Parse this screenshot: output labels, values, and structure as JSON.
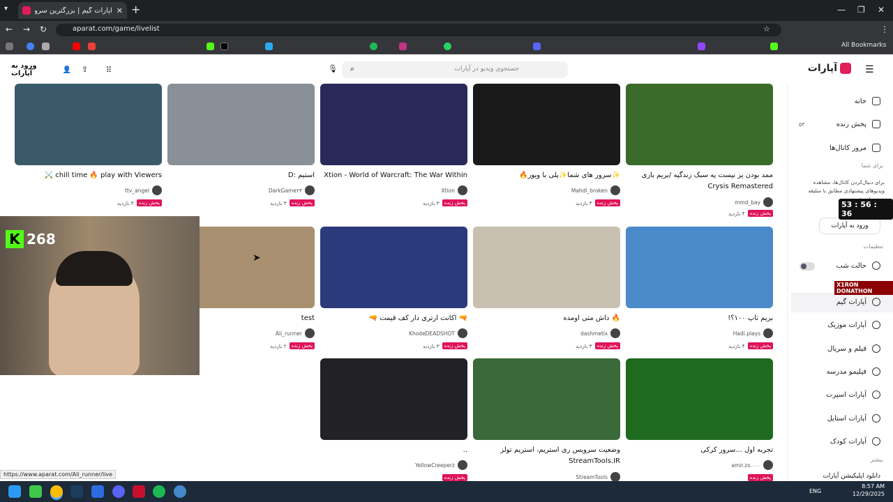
{
  "browser": {
    "tab_title": "آپارات گیم | بزرگترین سرویس استر",
    "url": "aparat.com/game/livelist",
    "all_bookmarks": "All Bookmarks",
    "status_url": "https://www.aparat.com/Ali_runner/live"
  },
  "header": {
    "logo": "آپارات",
    "search_placeholder": "جستجوی ویدیو در آپارات",
    "login": "ورود به آپارات"
  },
  "sidebar": {
    "items": [
      {
        "label": "خانه",
        "icon": "home-icon"
      },
      {
        "label": "پخش زنده",
        "icon": "live-icon",
        "count": "۵۳"
      },
      {
        "label": "مرور کانال‌ها",
        "icon": "channels-icon"
      },
      {
        "label": "حالت شب",
        "icon": "moon-icon"
      },
      {
        "label": "آپارات گیم",
        "icon": "game-icon"
      },
      {
        "label": "آپارات موزیک",
        "icon": "music-icon"
      },
      {
        "label": "فیلم و سریال",
        "icon": "film-icon"
      },
      {
        "label": "فیلیمو مدرسه",
        "icon": "school-icon"
      },
      {
        "label": "آپارات اسپرت",
        "icon": "sport-icon"
      },
      {
        "label": "آپارات استایل",
        "icon": "style-icon"
      },
      {
        "label": "آپارات کودک",
        "icon": "kids-icon"
      }
    ],
    "for_you": "برای شما",
    "for_you_text": "برای دنبال‌کردن کانال‌ها، مشاهده ویدیوهای پیشنهادی مطابق با سلیقه خود، وارد شوید.",
    "login_short": "ورود به آپارات",
    "settings": "تنظیمات",
    "more": "بیشتر",
    "download": "دانلود اپلیکیشن آپارات"
  },
  "overlay": {
    "kick_count": "268",
    "timer": "53 : 56 : 36",
    "donation": "X1RON DONATHON"
  },
  "live_badge": "پخش زنده",
  "cards": [
    {
      "title": "ممد بودن یز نیست یه سبک زندگیه /بریم بازی Crysis Remastered",
      "channel": "mmd_bay",
      "views": "۴ بازدید",
      "color": "#3a6b2a"
    },
    {
      "title": "✨سرور های شما✨پلی با ویور🔥",
      "channel": "Mahdi_broken",
      "views": "۴ بازدید",
      "color": "#1a1a1a"
    },
    {
      "title": "Xtion - World of Warcraft: The War Within",
      "channel": "Xtion",
      "views": "۳ بازدید",
      "color": "#2a2a5a"
    },
    {
      "title": "استیم :D",
      "channel": "DarkGame۲۴",
      "views": "۳ بازدید",
      "color": "#8a9098"
    },
    {
      "title": "chill time 🔥 play with Viewers ⚔️",
      "channel": "ttv_angel",
      "views": "۳ بازدید",
      "color": "#3a5a6a"
    },
    {
      "title": "بریم تاپ ۱۰۰؟!",
      "channel": "Hadi.plays",
      "views": "۴ بازدید",
      "color": "#4a8ac8"
    },
    {
      "title": "🔥 داش متی اومده",
      "channel": "dashmeti۸",
      "views": "۳ بازدید",
      "color": "#c8c0b0"
    },
    {
      "title": "🔫 اکانت ارتری دار کف قیمت 🔫",
      "channel": "KhodeDEADSHOT",
      "views": "۳ بازدید",
      "color": "#2a3a7a"
    },
    {
      "title": "test",
      "channel": "Ali_runner",
      "views": "۲ بازدید",
      "color": "#a89070"
    },
    {
      "title": "تجربه اول ...سرور کرکی",
      "channel": "amir.zx.۰۰۰",
      "views": "",
      "color": "#1e6a1e"
    },
    {
      "title": "وضعیت سرویس ری استریم، استریم تولز StreamTools.IR",
      "channel": "StreamTools",
      "views": "",
      "color": "#3a6a3a"
    },
    {
      "title": "..",
      "channel": "YellowCreeperz",
      "views": "",
      "color": "#222226"
    }
  ],
  "taskbar": {
    "lang": "ENG",
    "time": "8:57 AM",
    "date": "12/29/2025"
  }
}
